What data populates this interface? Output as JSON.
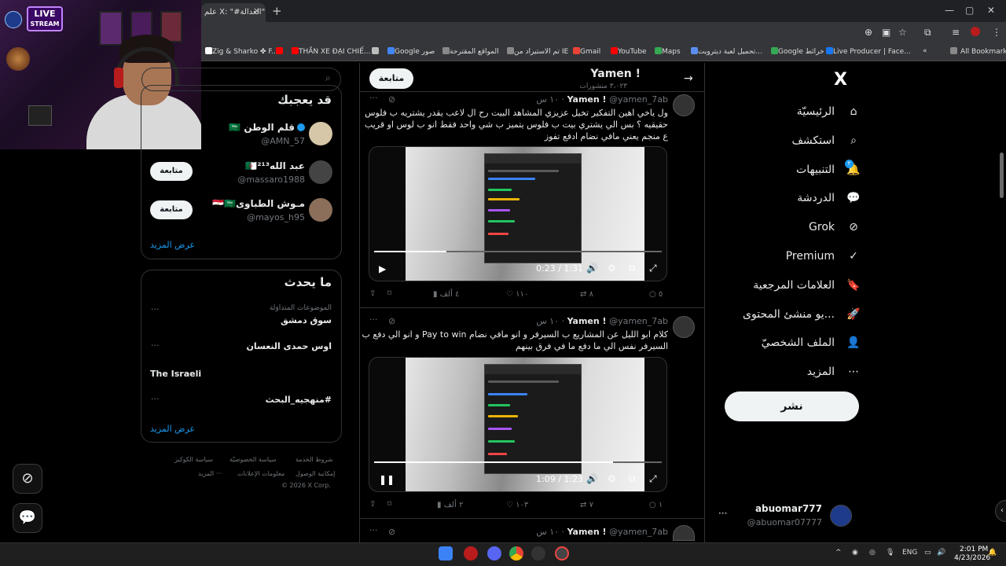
{
  "browser": {
    "tab_title": "علم X: \"#العدالة\" ©",
    "tab_close": "×",
    "new_tab": "+",
    "bookmarks": [
      {
        "label": "Zig & Sharko ✤ F...",
        "color": "#ffffff"
      },
      {
        "label": "",
        "color": "#ff0000"
      },
      {
        "label": "THẦN XE ĐẠI CHIẾ...",
        "color": "#ff0000"
      },
      {
        "label": "",
        "color": "#bbbbbb"
      },
      {
        "label": "Google صور",
        "color": "#4285f4"
      },
      {
        "label": "المواقع المقترحة",
        "color": "#888888"
      },
      {
        "label": "تم الاستيراد من IE",
        "color": "#888888"
      },
      {
        "label": "Gmail",
        "color": "#ea4335"
      },
      {
        "label": "YouTube",
        "color": "#ff0000"
      },
      {
        "label": "Maps",
        "color": "#34a853"
      },
      {
        "label": "تحميل لعبة ديترويت...",
        "color": "#5b8def"
      },
      {
        "label": "Google خرائط",
        "color": "#34a853"
      },
      {
        "label": "Live Producer | Face...",
        "color": "#1877f2"
      }
    ],
    "all_bookmarks": "All Bookmarks",
    "more_bookmarks": "»"
  },
  "webcam": {
    "badge_line1": "LIVE",
    "badge_line2": "STREAM"
  },
  "nav": {
    "logo": "X",
    "items": [
      {
        "label": "الرئيسيّة",
        "icon": "home-icon",
        "glyph": "⌂"
      },
      {
        "label": "استكشف",
        "icon": "search-icon",
        "glyph": "⌕"
      },
      {
        "label": "التنبيهات",
        "icon": "bell-icon",
        "glyph": "🔔"
      },
      {
        "label": "الدردشة",
        "icon": "chat-icon",
        "glyph": "💬"
      },
      {
        "label": "Grok",
        "icon": "grok-icon",
        "glyph": "⊘"
      },
      {
        "label": "Premium",
        "icon": "premium-icon",
        "glyph": "✓"
      },
      {
        "label": "العلامات المرجعية",
        "icon": "bookmark-icon",
        "glyph": "🔖"
      },
      {
        "label": "...يو منشئ المحتوى",
        "icon": "rocket-icon",
        "glyph": "🚀"
      },
      {
        "label": "الملف الشخصيّ",
        "icon": "profile-icon",
        "glyph": "👤"
      },
      {
        "label": "المزيد",
        "icon": "more-icon",
        "glyph": "⋯"
      }
    ],
    "notification_badge": "٢",
    "post_button": "نشر",
    "account_name": "abuomar777",
    "account_handle": "@abuomar07777",
    "account_more": "···"
  },
  "profile": {
    "back": "→",
    "name": "Yamen !",
    "post_count": "٣،٠٢٣ منشورات",
    "follow": "متابعة"
  },
  "posts": [
    {
      "name": "Yamen !",
      "handle": "@yamen_7ab",
      "time": "١٠ س",
      "more": "···",
      "text": "ول ياخي اهين التفكير تخيل عزيزي المشاهد البيت رح ال لاعب يقدر يشتريه ب فلوس حقيقيه ؟ بس الي يشتري بيت ب فلوس يتميز ب شي واحد فقط انو ب لوس او قريب ع منجم يعني مافي نضام ادفع تفوز",
      "video_time": "0:23 / 1:31",
      "progress": 0.25,
      "playing": false,
      "actions": {
        "replies": "٥",
        "reposts": "٨",
        "likes": "١١٠",
        "views": "٤ ألف"
      }
    },
    {
      "name": "Yamen !",
      "handle": "@yamen_7ab",
      "time": "١٠ س",
      "more": "···",
      "text": "كلام ابو الليل عن المشاريع ب السيرفر و انو مافي نضام Pay to win و انو الي دفع ب السيرفر نفس الي ما دفع ما في فرق بينهم",
      "video_time": "1:09 / 1:23",
      "progress": 0.83,
      "playing": true,
      "actions": {
        "replies": "١",
        "reposts": "٧",
        "likes": "١٠٣",
        "views": "٢ ألف"
      }
    },
    {
      "name": "Yamen !",
      "handle": "@yamen_7ab",
      "time": "١٠ س",
      "more": "···"
    }
  ],
  "who_to_follow": {
    "title": "قد يعجبك",
    "users": [
      {
        "name": "قلم الوطن 🇸🇦",
        "handle": "@AMN_57",
        "verified": true,
        "follow": ""
      },
      {
        "name": "عبد الله🇩🇿²¹³",
        "handle": "@massaro1988",
        "verified": false,
        "follow": "متابعة"
      },
      {
        "name": "مـوش الطباوى🇪🇬🇸🇦",
        "handle": "@mayos_h95",
        "verified": false,
        "follow": "متابعة"
      }
    ],
    "show_more": "عرض المزيد"
  },
  "trends": {
    "title": "ما يحدث",
    "items": [
      {
        "category": "الموضوعات المتداوَلة",
        "name": "سوق دمشق"
      },
      {
        "category": "",
        "name": "اوس حمدى النعسان"
      },
      {
        "category": "",
        "name": "The Israeli"
      },
      {
        "category": "",
        "name": "#منهجيه_البحث"
      }
    ],
    "more": "···",
    "show_more": "عرض المزيد"
  },
  "footer": {
    "links_row1": [
      "شروط الخدمة",
      "سياسة الخصوصيّة",
      "سياسة الكوكيز"
    ],
    "links_row2": [
      "إمكانية الوصول",
      "معلومات الإعلانات",
      "··· المزيد"
    ],
    "copyright": "© 2026 X Corp."
  },
  "floating": {
    "grok": "⊘",
    "chat": "💬"
  },
  "taskbar": {
    "tray_lang": "ENG",
    "time": "2:01 PM",
    "date": "4/23/2026",
    "chevron": "^"
  }
}
